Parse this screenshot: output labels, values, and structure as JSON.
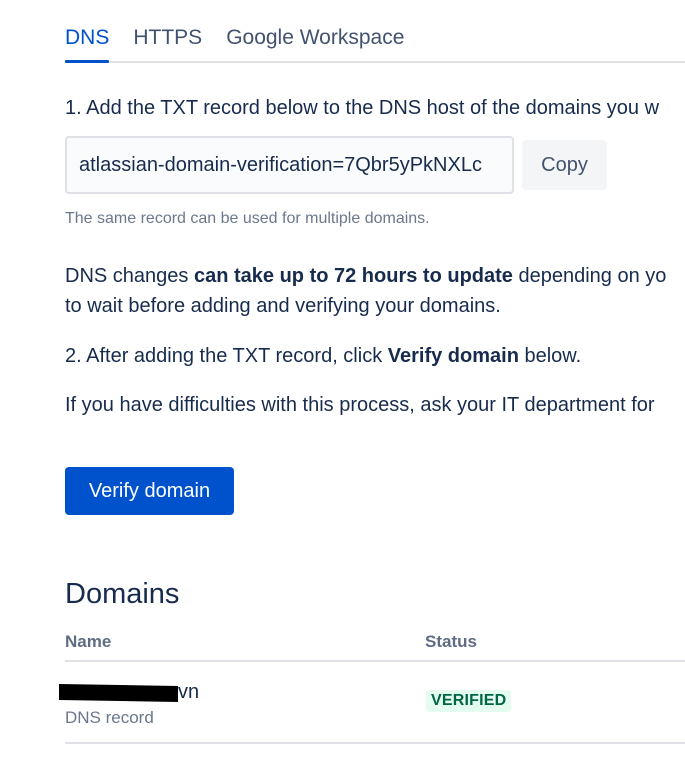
{
  "tabs": [
    {
      "label": "DNS",
      "active": true
    },
    {
      "label": "HTTPS",
      "active": false
    },
    {
      "label": "Google Workspace",
      "active": false
    }
  ],
  "steps": {
    "step1": "1. Add the TXT record below to the DNS host of the domains you w",
    "record_value": "atlassian-domain-verification=7Qbr5yPkNXLc",
    "copy_label": "Copy",
    "hint": "The same record can be used for multiple domains.",
    "dns_prefix": "DNS changes ",
    "dns_bold": "can take up to 72 hours to update",
    "dns_suffix": " depending on yo",
    "dns_line2": "to wait before adding and verifying your domains.",
    "step2_prefix": "2. After adding the TXT record, click ",
    "step2_bold": "Verify domain",
    "step2_suffix": " below.",
    "difficulties": "If you have difficulties with this process, ask your IT department for"
  },
  "verify_button": "Verify domain",
  "domains": {
    "heading": "Domains",
    "columns": {
      "name": "Name",
      "status": "Status"
    },
    "rows": [
      {
        "name_visible": "vn",
        "type": "DNS record",
        "status": "VERIFIED"
      }
    ]
  },
  "colors": {
    "accent": "#0052cc",
    "verified_bg": "#e3fcef",
    "verified_text": "#006644"
  }
}
